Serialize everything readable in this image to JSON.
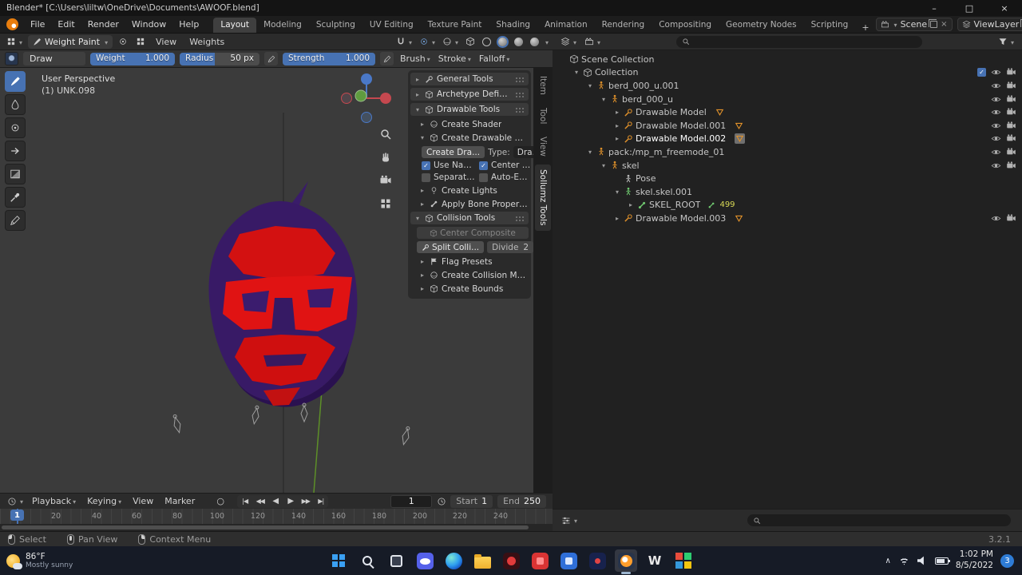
{
  "titlebar": {
    "title": "Blender* [C:\\Users\\liltw\\OneDrive\\Documents\\AWOOF.blend]",
    "minimize": "–",
    "maximize": "□",
    "close": "×"
  },
  "menubar": {
    "menus": [
      "File",
      "Edit",
      "Render",
      "Window",
      "Help"
    ],
    "workspaces": [
      "Layout",
      "Modeling",
      "Sculpting",
      "UV Editing",
      "Texture Paint",
      "Shading",
      "Animation",
      "Rendering",
      "Compositing",
      "Geometry Nodes",
      "Scripting"
    ],
    "add_workspace": "+",
    "scene_name": "Scene",
    "view_layer_name": "ViewLayer"
  },
  "viewport_header": {
    "mode": "Weight Paint",
    "menus": [
      "View",
      "Weights"
    ]
  },
  "tool_settings": {
    "brush_name": "Draw",
    "weight_label": "Weight",
    "weight_value": "1.000",
    "radius_label": "Radius",
    "radius_value": "50 px",
    "strength_label": "Strength",
    "strength_value": "1.000",
    "brush_menu": "Brush",
    "stroke_menu": "Stroke",
    "falloff_menu": "Falloff"
  },
  "viewport": {
    "view_label": "User Perspective",
    "object_label": "(1) UNK.098"
  },
  "side_tabs": {
    "items": [
      "Item",
      "Tool",
      "View",
      "Sollumz Tools"
    ]
  },
  "sollumz": {
    "sections": {
      "general": "General Tools",
      "archetype": "Archetype Definition",
      "drawable": "Drawable Tools",
      "collision": "Collision Tools"
    },
    "drawable": {
      "create_shader": "Create Shader",
      "create_drawable_objects": "Create Drawable Objects",
      "create_button": "Create Dra...",
      "type_label": "Type:",
      "type_value": "Dra...",
      "checkboxes": [
        {
          "label": "Use Nam...",
          "checked": true
        },
        {
          "label": "Center to ...",
          "checked": true
        },
        {
          "label": "Separate ...",
          "checked": false
        },
        {
          "label": "Auto-Emb...",
          "checked": false
        }
      ],
      "create_lights": "Create Lights",
      "apply_bone_properties": "Apply Bone Properties"
    },
    "collision": {
      "center_composite": "Center Composite",
      "split_collision": "Split Colli...",
      "divide_label": "Divide",
      "divide_value": "2",
      "flag_presets": "Flag Presets",
      "create_collision_material": "Create Collision Material",
      "create_bounds": "Create Bounds"
    }
  },
  "outliner": {
    "rows": [
      {
        "label": "Scene Collection"
      },
      {
        "label": "Collection"
      },
      {
        "label": "berd_000_u.001"
      },
      {
        "label": "berd_000_u"
      },
      {
        "label": "Drawable Model"
      },
      {
        "label": "Drawable Model.001"
      },
      {
        "label": "Drawable Model.002"
      },
      {
        "label": "pack:/mp_m_freemode_01"
      },
      {
        "label": "skel"
      },
      {
        "label": "Pose"
      },
      {
        "label": "skel.skel.001"
      },
      {
        "label": "SKEL_ROOT",
        "count": "499"
      },
      {
        "label": "Drawable Model.003"
      }
    ]
  },
  "timeline": {
    "menus": [
      "Playback",
      "Keying",
      "View",
      "Marker"
    ],
    "transport": {
      "record": "○",
      "jump_start": "|◀",
      "prev_key": "◀◀",
      "play_rev": "◀",
      "play": "▶",
      "next_key": "▶▶",
      "jump_end": "▶|"
    },
    "current_frame": "1",
    "start_label": "Start",
    "start_value": "1",
    "end_label": "End",
    "end_value": "250",
    "ruler_labels": [
      "20",
      "40",
      "60",
      "80",
      "100",
      "120",
      "140",
      "160",
      "180",
      "200",
      "220",
      "240"
    ],
    "playhead": "1"
  },
  "statusbar": {
    "select": "Select",
    "pan": "Pan View",
    "context": "Context Menu",
    "version": "3.2.1"
  },
  "taskbar": {
    "weather_temp": "86°F",
    "weather_desc": "Mostly sunny",
    "word_glyph": "W",
    "clock_time": "1:02 PM",
    "clock_date": "8/5/2022",
    "badge": "3"
  }
}
